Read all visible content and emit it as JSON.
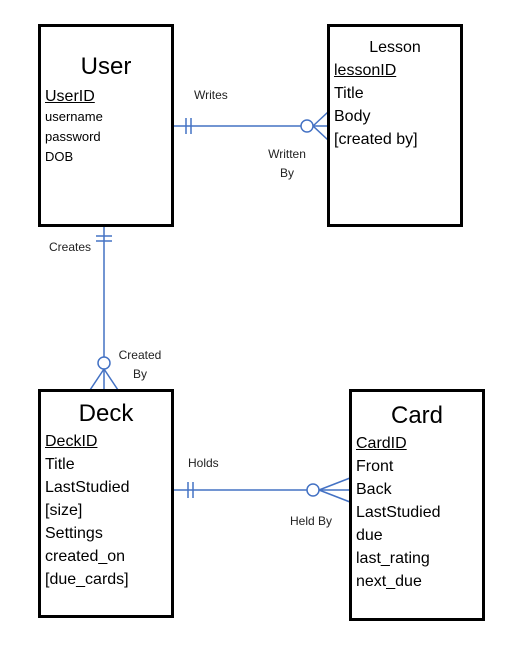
{
  "entities": {
    "user": {
      "title": "User",
      "attributes": [
        "UserID",
        "username",
        "password",
        "DOB"
      ],
      "primary_key": "UserID"
    },
    "lesson": {
      "title": "Lesson",
      "attributes": [
        "lessonID",
        "Title",
        "Body",
        "[created by]"
      ],
      "primary_key": "lessonID"
    },
    "deck": {
      "title": "Deck",
      "attributes": [
        "DeckID",
        "Title",
        "LastStudied",
        "[size]",
        "Settings",
        "created_on",
        "[due_cards]"
      ],
      "primary_key": "DeckID"
    },
    "card": {
      "title": "Card",
      "attributes": [
        "CardID",
        "Front",
        "Back",
        "LastStudied",
        "due",
        "last_rating",
        "next_due"
      ],
      "primary_key": "CardID"
    }
  },
  "relationships": {
    "user_lesson": {
      "from_label": "Writes",
      "to_label_line1": "Written",
      "to_label_line2": "By",
      "cardinality": "one-to-many"
    },
    "user_deck": {
      "from_label": "Creates",
      "to_label_line1": "Created",
      "to_label_line2": "By",
      "cardinality": "one-to-many"
    },
    "deck_card": {
      "from_label": "Holds",
      "to_label": "Held By",
      "cardinality": "one-to-many"
    }
  },
  "colors": {
    "connector": "#4472c4",
    "border": "#000000"
  }
}
